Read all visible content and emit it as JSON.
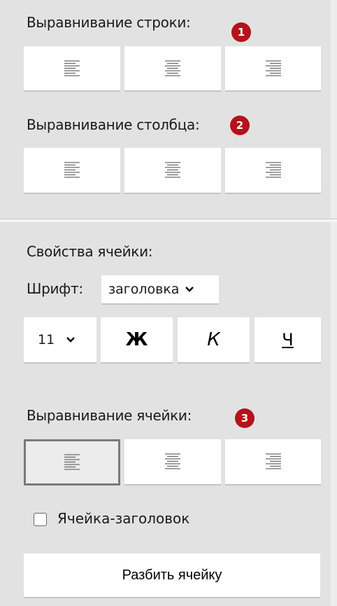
{
  "row_alignment": {
    "label": "Выравнивание строки:",
    "badge": "1",
    "buttons": [
      {
        "icon": "align-left-icon"
      },
      {
        "icon": "align-center-icon"
      },
      {
        "icon": "align-right-icon"
      }
    ]
  },
  "column_alignment": {
    "label": "Выравнивание столбца:",
    "badge": "2",
    "buttons": [
      {
        "icon": "align-top-icon"
      },
      {
        "icon": "align-middle-icon"
      },
      {
        "icon": "align-bottom-icon"
      }
    ]
  },
  "cell_properties": {
    "label": "Свойства ячейки:",
    "font_label": "Шрифт:",
    "font_value": "заголовка",
    "font_size": "11",
    "bold_label": "Ж",
    "italic_label": "К",
    "underline_label": "Ч"
  },
  "cell_alignment": {
    "label": "Выравнивание ячейки:",
    "badge": "3",
    "active_index": 0,
    "buttons": [
      {
        "icon": "align-left-icon"
      },
      {
        "icon": "align-center-icon"
      },
      {
        "icon": "align-right-icon"
      }
    ]
  },
  "header_cell": {
    "label": "Ячейка-заголовок",
    "checked": false
  },
  "split_button": {
    "label": "Разбить ячейку"
  },
  "colors": {
    "badge": "#b5121b",
    "panel": "#e2e2e2",
    "button": "#ffffff"
  }
}
